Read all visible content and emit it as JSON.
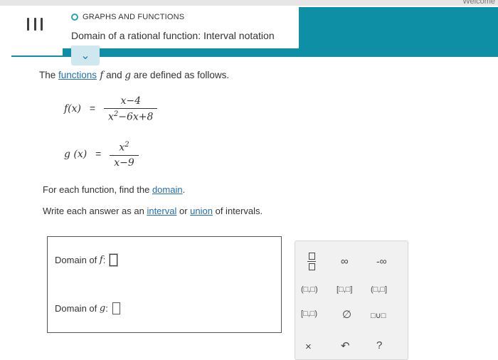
{
  "header": {
    "category": "GRAPHS AND FUNCTIONS",
    "title": "Domain of a rational function: Interval notation",
    "welcome": "Welcome"
  },
  "intro": {
    "prefix": "The ",
    "link": "functions",
    "suffix": " and ",
    "end": " are defined as follows."
  },
  "f": {
    "lhs": "f(x)",
    "eq": "=",
    "numerator": "x−4",
    "den_pre": "x",
    "den_exp": "2",
    "den_post": "−6x+8"
  },
  "g": {
    "lhs": "g (x)",
    "eq": "=",
    "num_base": "x",
    "num_exp": "2",
    "denominator": "x−9"
  },
  "instructions": {
    "line1_pre": "For each function, find the ",
    "line1_link": "domain",
    "line1_end": ".",
    "line2_pre": "Write each answer as an ",
    "line2_link1": "interval",
    "line2_mid": " or ",
    "line2_link2": "union",
    "line2_end": " of intervals."
  },
  "answers": {
    "f_label": "Domain of",
    "f_var": "f",
    "g_label": "Domain of",
    "g_var": "g",
    "colon": " : "
  },
  "palette": {
    "infinity": "∞",
    "neg_infinity": "-∞",
    "open_open": "(□,□)",
    "closed_closed": "[□,□]",
    "open_closed": "(□,□]",
    "closed_open": "[□,□)",
    "empty_set": "∅",
    "union": "□∪□",
    "clear": "×",
    "undo": "↶",
    "help": "?"
  }
}
